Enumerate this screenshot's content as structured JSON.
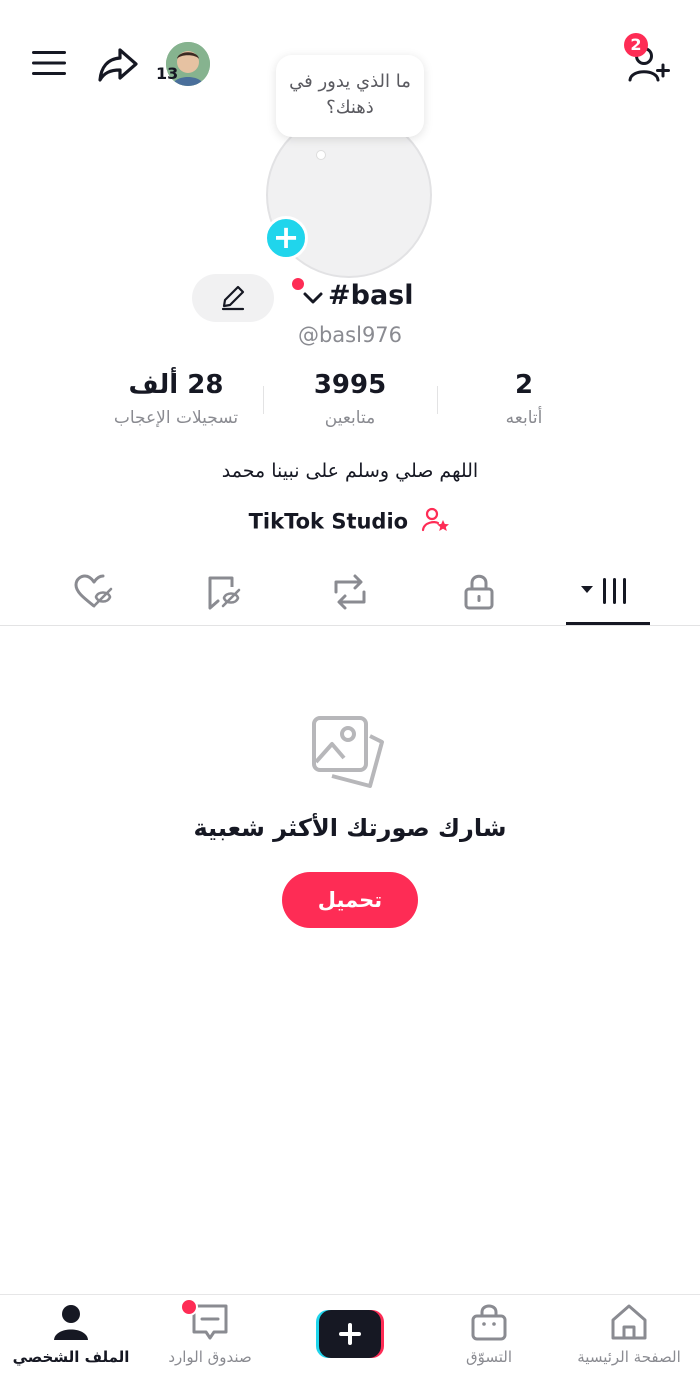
{
  "header": {
    "friend_count": "13",
    "notification_count": "2"
  },
  "profile": {
    "thought_bubble_text": "ما الذي يدور في ذهنك؟",
    "display_name": "#basl",
    "username": "@basl976",
    "bio": "اللهم صلي وسلم على نبينا محمد",
    "studio_link": "TikTok Studio",
    "stats": {
      "following": {
        "value": "2",
        "label": "أتابعه"
      },
      "followers": {
        "value": "3995",
        "label": "متابعين"
      },
      "likes": {
        "value": "28 ألف",
        "label": "تسجيلات الإعجاب"
      }
    }
  },
  "tabs": [
    {
      "icon": "grid-icon",
      "active": true
    },
    {
      "icon": "lock-icon"
    },
    {
      "icon": "repost-icon"
    },
    {
      "icon": "bookmark-icon"
    },
    {
      "icon": "liked-icon"
    }
  ],
  "empty_state": {
    "title": "شارك صورتك الأكثر شعبية",
    "button": "تحميل"
  },
  "bottom_nav": {
    "home": "الصفحة الرئيسية",
    "shop": "التسوّق",
    "inbox": "صندوق الوارد",
    "profile": "الملف الشخصي"
  },
  "colors": {
    "accent": "#fe2c55",
    "cyan": "#20d5ec",
    "text": "#161823",
    "muted": "#8a8b91"
  }
}
